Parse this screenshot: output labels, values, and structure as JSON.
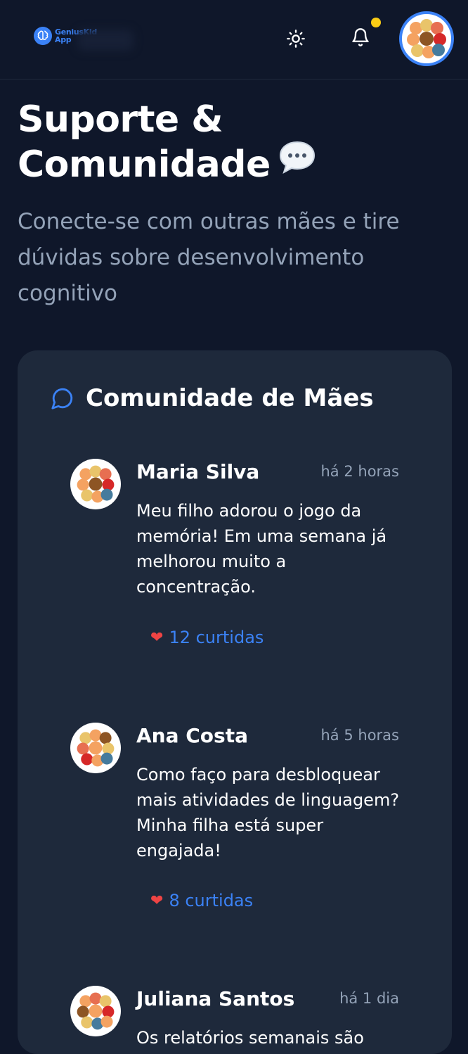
{
  "header": {
    "logo_line1": "GeniusKid",
    "logo_line2": "App",
    "icons": [
      "brain-icon",
      "sun-icon",
      "bell-icon"
    ],
    "notification_dot_color": "#facc15"
  },
  "hero": {
    "title_line1": "Suporte &",
    "title_line2": "Comunidade",
    "subtitle": "Conecte-se com outras mães e tire dúvidas sobre desenvolvimento cognitivo"
  },
  "community": {
    "title": "Comunidade de Mães",
    "posts": [
      {
        "author": "Maria Silva",
        "time": "há 2 horas",
        "body": "Meu filho adorou o jogo da memória! Em uma semana já melhorou muito a concentração.",
        "likes": "12 curtidas"
      },
      {
        "author": "Ana Costa",
        "time": "há 5 horas",
        "body": "Como faço para desbloquear mais atividades de linguagem? Minha filha está super engajada!",
        "likes": "8 curtidas"
      },
      {
        "author": "Juliana Santos",
        "time": "há 1 dia",
        "body": "Os relatórios semanais são",
        "likes": ""
      }
    ]
  },
  "colors": {
    "background": "#0f172a",
    "card": "#1e293b",
    "accent": "#3b82f6",
    "muted": "#94a3b8"
  }
}
